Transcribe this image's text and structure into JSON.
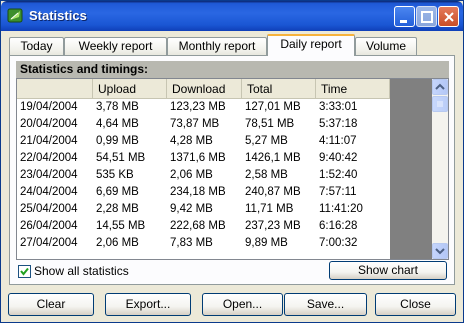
{
  "window": {
    "title": "Statistics"
  },
  "tabs": [
    {
      "label": "Today"
    },
    {
      "label": "Weekly report"
    },
    {
      "label": "Monthly report"
    },
    {
      "label": "Daily report"
    },
    {
      "label": "Volume"
    }
  ],
  "panel": {
    "group_title": "Statistics and timings:",
    "columns": [
      "",
      "Upload",
      "Download",
      "Total",
      "Time"
    ],
    "rows": [
      [
        "19/04/2004",
        "3,78 MB",
        "123,23 MB",
        "127,01 MB",
        "3:33:01"
      ],
      [
        "20/04/2004",
        "4,64 MB",
        "73,87 MB",
        "78,51 MB",
        "5:37:18"
      ],
      [
        "21/04/2004",
        "0,99 MB",
        "4,28 MB",
        "5,27 MB",
        "4:11:07"
      ],
      [
        "22/04/2004",
        "54,51 MB",
        "1371,6 MB",
        "1426,1 MB",
        "9:40:42"
      ],
      [
        "23/04/2004",
        "535 KB",
        "2,06 MB",
        "2,58 MB",
        "1:52:40"
      ],
      [
        "24/04/2004",
        "6,69 MB",
        "234,18 MB",
        "240,87 MB",
        "7:57:11"
      ],
      [
        "25/04/2004",
        "2,28 MB",
        "9,42 MB",
        "11,71 MB",
        "11:41:20"
      ],
      [
        "26/04/2004",
        "14,55 MB",
        "222,68 MB",
        "237,23 MB",
        "6:16:28"
      ],
      [
        "27/04/2004",
        "2,06 MB",
        "7,83 MB",
        "9,89 MB",
        "7:00:32"
      ]
    ],
    "show_all_label": "Show all statistics",
    "show_all_checked": true,
    "show_chart_label": "Show chart"
  },
  "buttons": {
    "clear": "Clear",
    "export": "Export...",
    "open": "Open...",
    "save": "Save...",
    "close": "Close"
  }
}
